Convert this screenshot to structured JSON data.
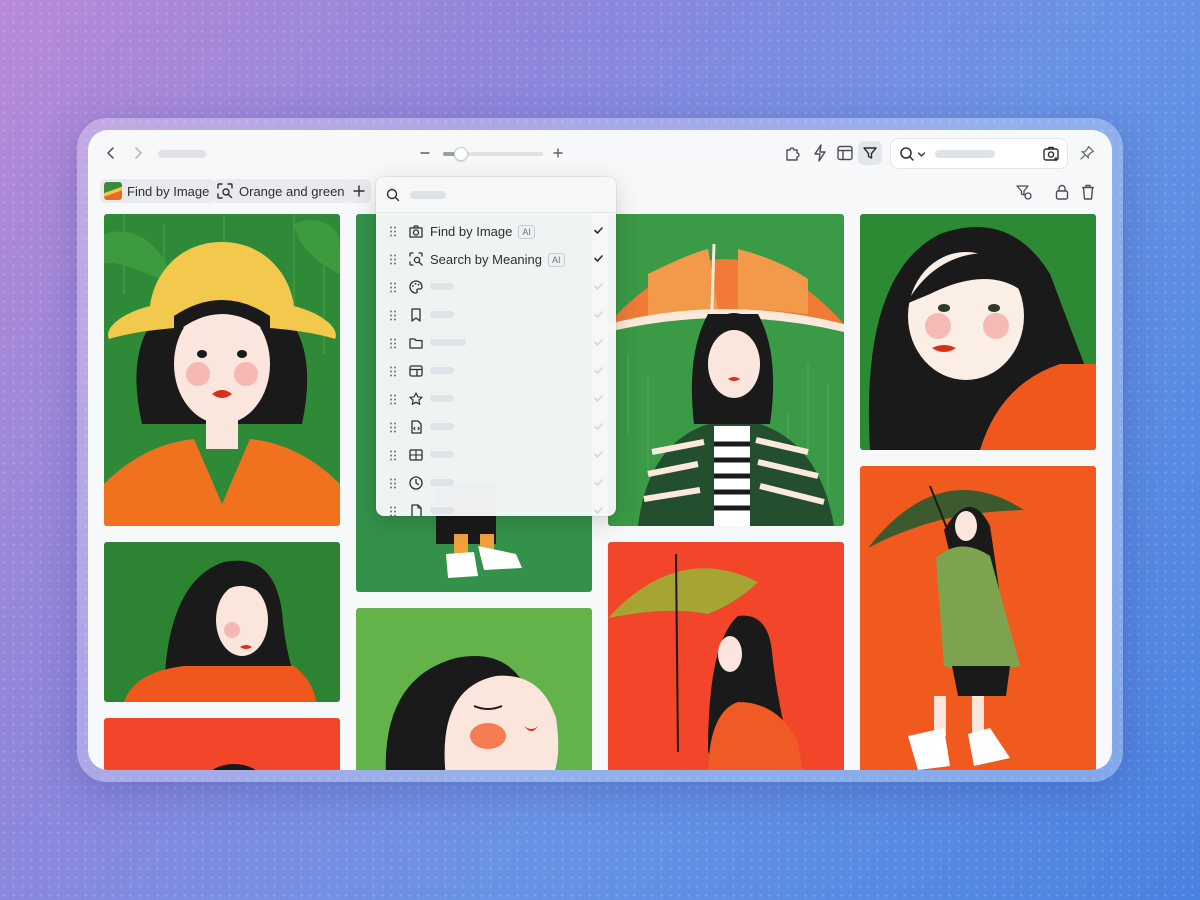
{
  "tags": [
    {
      "label": "Find by Image"
    },
    {
      "label": "Orange and green"
    }
  ],
  "dropdown": {
    "items": [
      {
        "label": "Find by Image",
        "badge": "AI",
        "icon": "camera-icon",
        "checked": true
      },
      {
        "label": "Search by Meaning",
        "badge": "AI",
        "icon": "scan-search-icon",
        "checked": true
      },
      {
        "label": "",
        "icon": "palette-icon",
        "checked": false
      },
      {
        "label": "",
        "icon": "bookmark-icon",
        "checked": false
      },
      {
        "label": "",
        "icon": "folder-icon",
        "checked": false
      },
      {
        "label": "",
        "icon": "layout-icon",
        "checked": false
      },
      {
        "label": "",
        "icon": "star-icon",
        "checked": false
      },
      {
        "label": "",
        "icon": "code-file-icon",
        "checked": false
      },
      {
        "label": "",
        "icon": "dimensions-icon",
        "checked": false
      },
      {
        "label": "",
        "icon": "clock-icon",
        "checked": false
      },
      {
        "label": "",
        "icon": "file-icon",
        "checked": false
      }
    ]
  },
  "zoom": {
    "level": 0.18
  },
  "colors": {
    "green": "#2f8a38",
    "light_green": "#63b34a",
    "orange": "#f0571c",
    "red_orange": "#f2452a",
    "yellow": "#f2c84d"
  }
}
